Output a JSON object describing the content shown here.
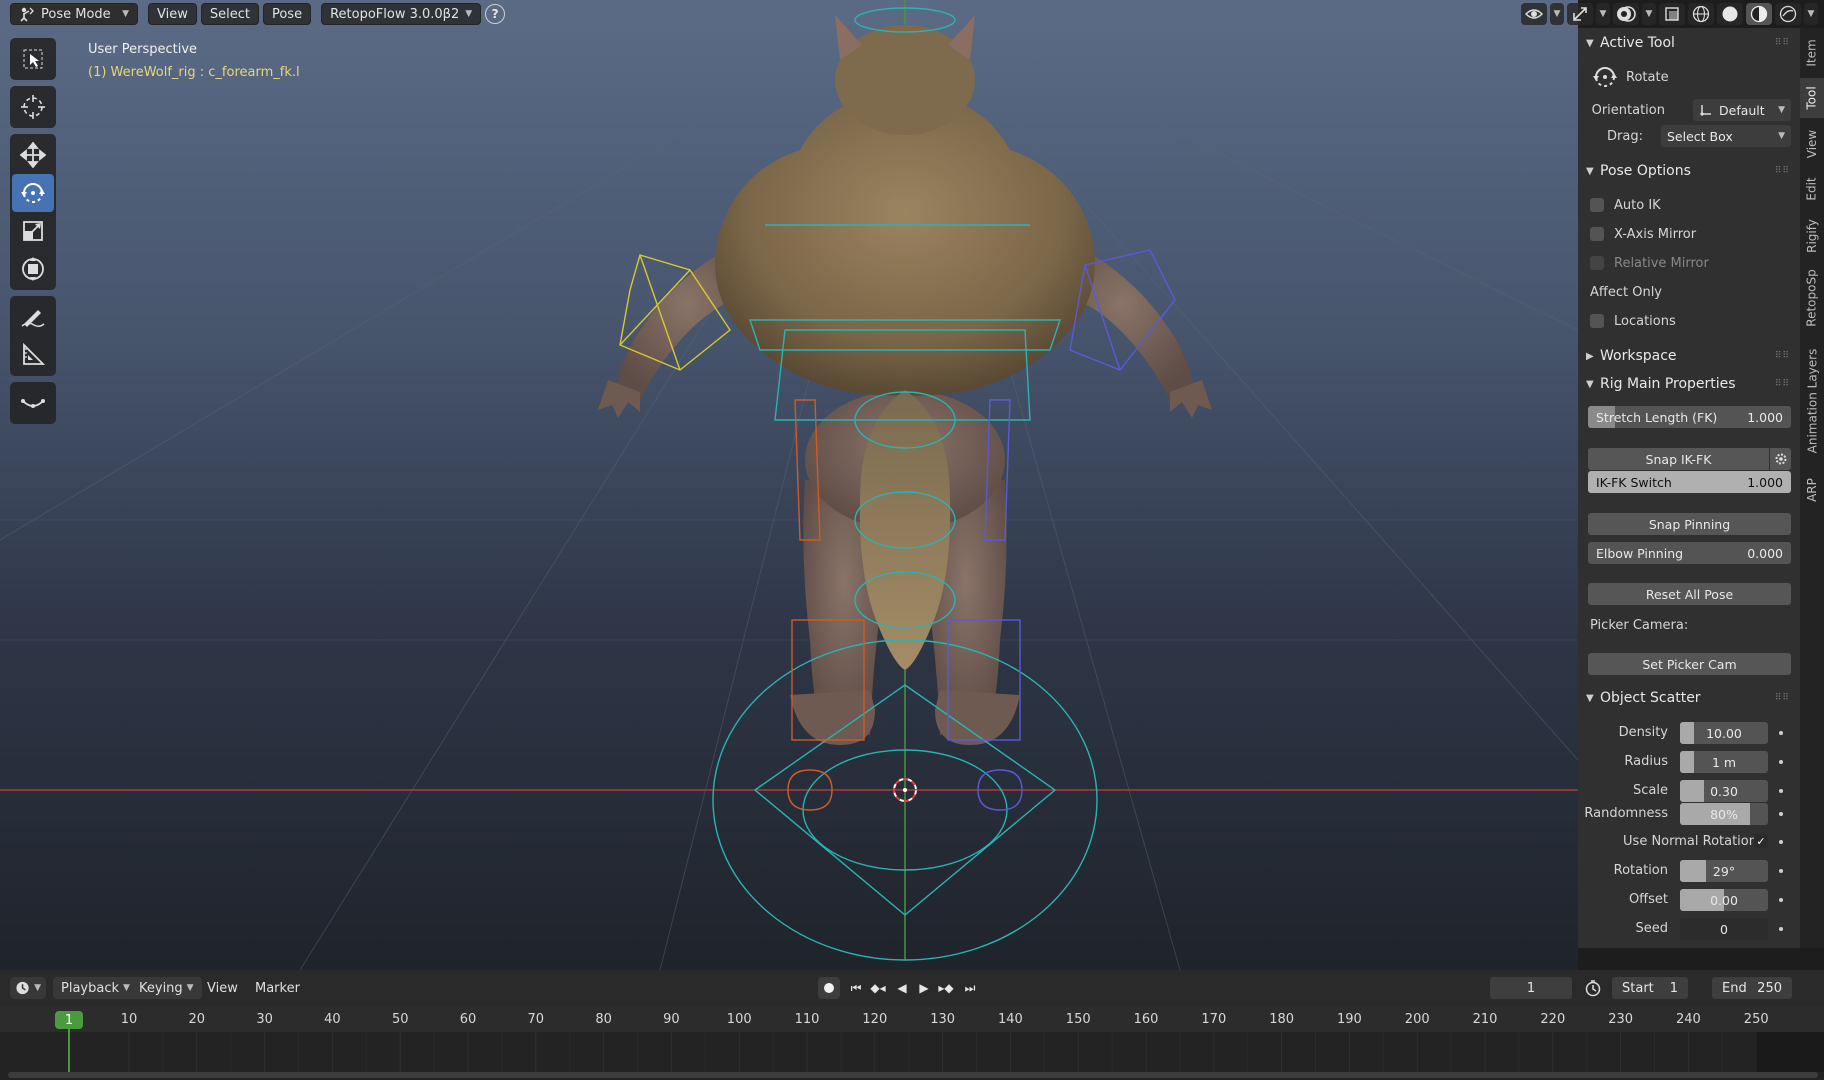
{
  "header": {
    "mode": "Pose Mode",
    "menus": [
      "View",
      "Select",
      "Pose"
    ],
    "addon": "RetopoFlow 3.0.0β2",
    "help_glyph": "?"
  },
  "viewport": {
    "view_name": "User Perspective",
    "object_info": "(1) WereWolf_rig : c_forearm_fk.l"
  },
  "tools": [
    "select-box",
    "cursor",
    "move",
    "rotate",
    "scale",
    "transform",
    "annotate",
    "measure",
    "relax"
  ],
  "active_tool": "rotate",
  "sidebar_tabs": [
    "Item",
    "Tool",
    "View",
    "Edit",
    "Rigify",
    "RetopoSp",
    "Animation Layers",
    "ARP"
  ],
  "active_sidebar_tab": "Tool",
  "active_tool_panel": {
    "title": "Active Tool",
    "tool_name": "Rotate",
    "orientation_label": "Orientation",
    "orientation_value": "Default",
    "drag_label": "Drag:",
    "drag_value": "Select Box"
  },
  "pose_options": {
    "title": "Pose Options",
    "auto_ik": "Auto IK",
    "x_axis_mirror": "X-Axis Mirror",
    "relative_mirror": "Relative Mirror",
    "affect_only": "Affect Only",
    "locations": "Locations"
  },
  "workspace": {
    "title": "Workspace"
  },
  "rig_main": {
    "title": "Rig Main Properties",
    "stretch_label": "Stretch Length (FK)",
    "stretch_value": "1.000",
    "snap_ikfk": "Snap IK-FK",
    "ikfk_switch_label": "IK-FK Switch",
    "ikfk_switch_value": "1.000",
    "snap_pinning": "Snap Pinning",
    "elbow_pinning_label": "Elbow Pinning",
    "elbow_pinning_value": "0.000",
    "reset_all_pose": "Reset All Pose",
    "picker_camera": "Picker Camera:",
    "set_picker_cam": "Set Picker Cam"
  },
  "object_scatter": {
    "title": "Object Scatter",
    "density_label": "Density",
    "density_value": "10.00",
    "radius_label": "Radius",
    "radius_value": "1 m",
    "scale_label": "Scale",
    "scale_value": "0.30",
    "randomness_label": "Randomness",
    "randomness_value": "80%",
    "randomness_fraction": 0.8,
    "use_normal_rotation": "Use Normal Rotation",
    "use_normal_rotation_checked": true,
    "rotation_label": "Rotation",
    "rotation_value": "29°",
    "offset_label": "Offset",
    "offset_value": "0.00",
    "seed_label": "Seed",
    "seed_value": "0",
    "check_glyph": "✓"
  },
  "timeline": {
    "menus": {
      "playback": "Playback",
      "keying": "Keying",
      "view": "View",
      "marker": "Marker"
    },
    "current_frame": "1",
    "start_label": "Start",
    "start_value": "1",
    "end_label": "End",
    "end_value": "250",
    "ticks": [
      "1",
      "10",
      "20",
      "30",
      "40",
      "50",
      "60",
      "70",
      "80",
      "90",
      "100",
      "110",
      "120",
      "130",
      "140",
      "150",
      "160",
      "170",
      "180",
      "190",
      "200",
      "210",
      "220",
      "230",
      "240",
      "250"
    ],
    "current_frame_badge": "1"
  },
  "colors": {
    "active_blue": "#4772b3",
    "frame_green": "#4c9a3f",
    "rig_cyan": "#2bb3b3",
    "rig_orange": "#d05a2a",
    "rig_blue": "#5a5ad8",
    "rig_yellow": "#d8c830",
    "info_yellow": "#e8d77a"
  }
}
